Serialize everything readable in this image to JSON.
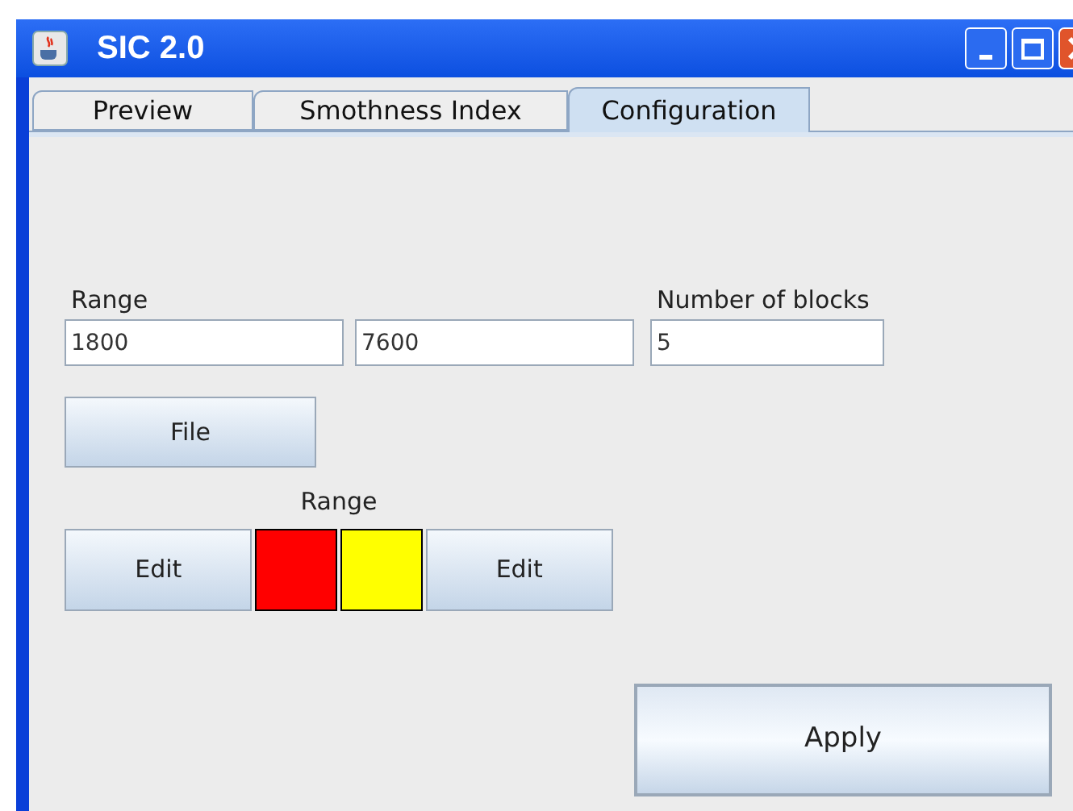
{
  "window": {
    "title": "SIC 2.0"
  },
  "tabs": [
    {
      "label": "Preview",
      "selected": false
    },
    {
      "label": "Smothness Index",
      "selected": false
    },
    {
      "label": "Configuration",
      "selected": true
    }
  ],
  "range": {
    "label": "Range",
    "from": "1800",
    "to": "7600"
  },
  "blocks": {
    "label": "Number of blocks",
    "value": "5"
  },
  "file_button": "File",
  "color_range": {
    "label": "Range",
    "edit_buttons": [
      "Edit",
      "Edit"
    ],
    "swatches": [
      {
        "color": "#ff0000"
      },
      {
        "color": "#ffff00"
      }
    ]
  },
  "apply_button": "Apply"
}
